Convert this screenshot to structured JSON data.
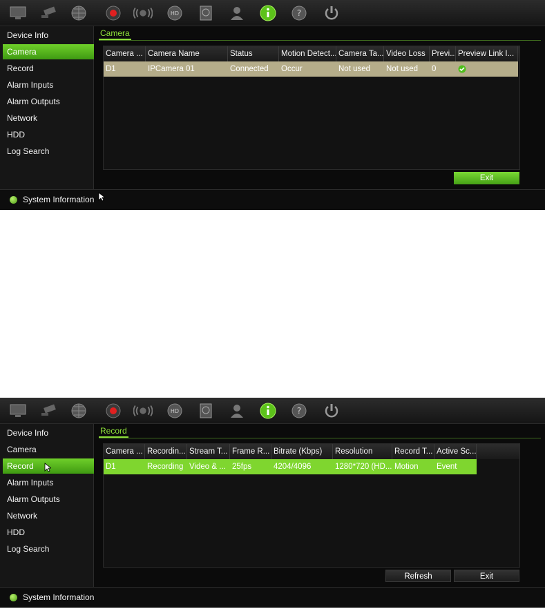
{
  "toolbar_icons": [
    "monitor-icon",
    "camera-icon",
    "network-globe-icon",
    "record-icon",
    "alarm-icon",
    "hdd-icon",
    "disk-icon",
    "user-icon",
    "info-icon",
    "help-icon",
    "power-icon"
  ],
  "colors": {
    "accent": "#6fcf2a",
    "background": "#0c0c0c",
    "row_selected_camera": "#b5ad8a",
    "row_selected_record": "#7fd62f"
  },
  "sidebar": {
    "items": [
      {
        "label": "Device Info"
      },
      {
        "label": "Camera"
      },
      {
        "label": "Record"
      },
      {
        "label": "Alarm Inputs"
      },
      {
        "label": "Alarm Outputs"
      },
      {
        "label": "Network"
      },
      {
        "label": "HDD"
      },
      {
        "label": "Log Search"
      }
    ]
  },
  "status_bar": {
    "label": "System Information"
  },
  "camera_panel": {
    "tab": "Camera",
    "columns": [
      "Camera ...",
      "Camera Name",
      "Status",
      "Motion Detect...",
      "Camera Ta...",
      "Video Loss",
      "Previ...",
      "Preview Link I..."
    ],
    "rows": [
      {
        "camera": "D1",
        "name": "IPCamera 01",
        "status": "Connected",
        "motion": "Occur",
        "tamper": "Not used",
        "video_loss": "Not used",
        "preview": "0",
        "preview_link": "check-icon"
      }
    ],
    "exit": "Exit"
  },
  "record_panel": {
    "tab": "Record",
    "columns": [
      "Camera ...",
      "Recordin...",
      "Stream T...",
      "Frame R...",
      "Bitrate (Kbps)",
      "Resolution",
      "Record T...",
      "Active Sc..."
    ],
    "rows": [
      {
        "camera": "D1",
        "recording": "Recording",
        "stream": "Video & ...",
        "frame_rate": "25fps",
        "bitrate": "4204/4096",
        "resolution": "1280*720 (HD...",
        "record_type": "Motion",
        "active_schedule": "Event"
      }
    ],
    "refresh": "Refresh",
    "exit": "Exit"
  }
}
